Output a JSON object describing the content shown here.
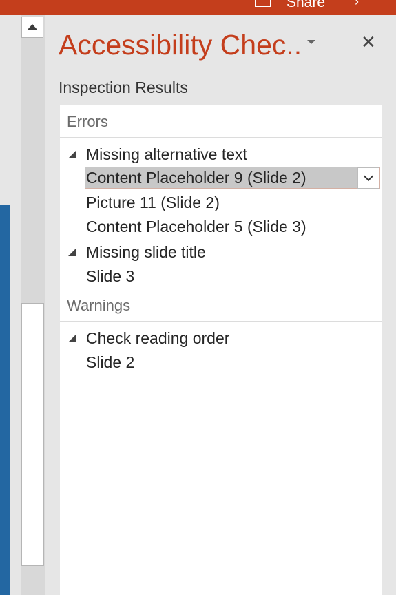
{
  "ribbon": {
    "share_label": "Share",
    "color": "#c43e1c",
    "share_icon": "share-icon",
    "next_icon": "chevron-right-icon"
  },
  "pane": {
    "title": "Accessibility Chec..",
    "title_color": "#c43e1c",
    "dropdown_icon": "triangle-down-icon",
    "close_icon": "close-icon",
    "close_glyph": "✕",
    "section_label": "Inspection Results"
  },
  "results": {
    "errors": {
      "header": "Errors",
      "categories": [
        {
          "label": "Missing alternative text",
          "items": [
            "Content Placeholder 9  (Slide 2)",
            "Picture 11  (Slide 2)",
            "Content Placeholder 5  (Slide 3)"
          ]
        },
        {
          "label": "Missing slide title",
          "items": [
            "Slide 3"
          ]
        }
      ]
    },
    "warnings": {
      "header": "Warnings",
      "categories": [
        {
          "label": "Check reading order",
          "items": [
            "Slide 2"
          ]
        }
      ]
    },
    "selected_item": "Content Placeholder 9  (Slide 2)"
  }
}
